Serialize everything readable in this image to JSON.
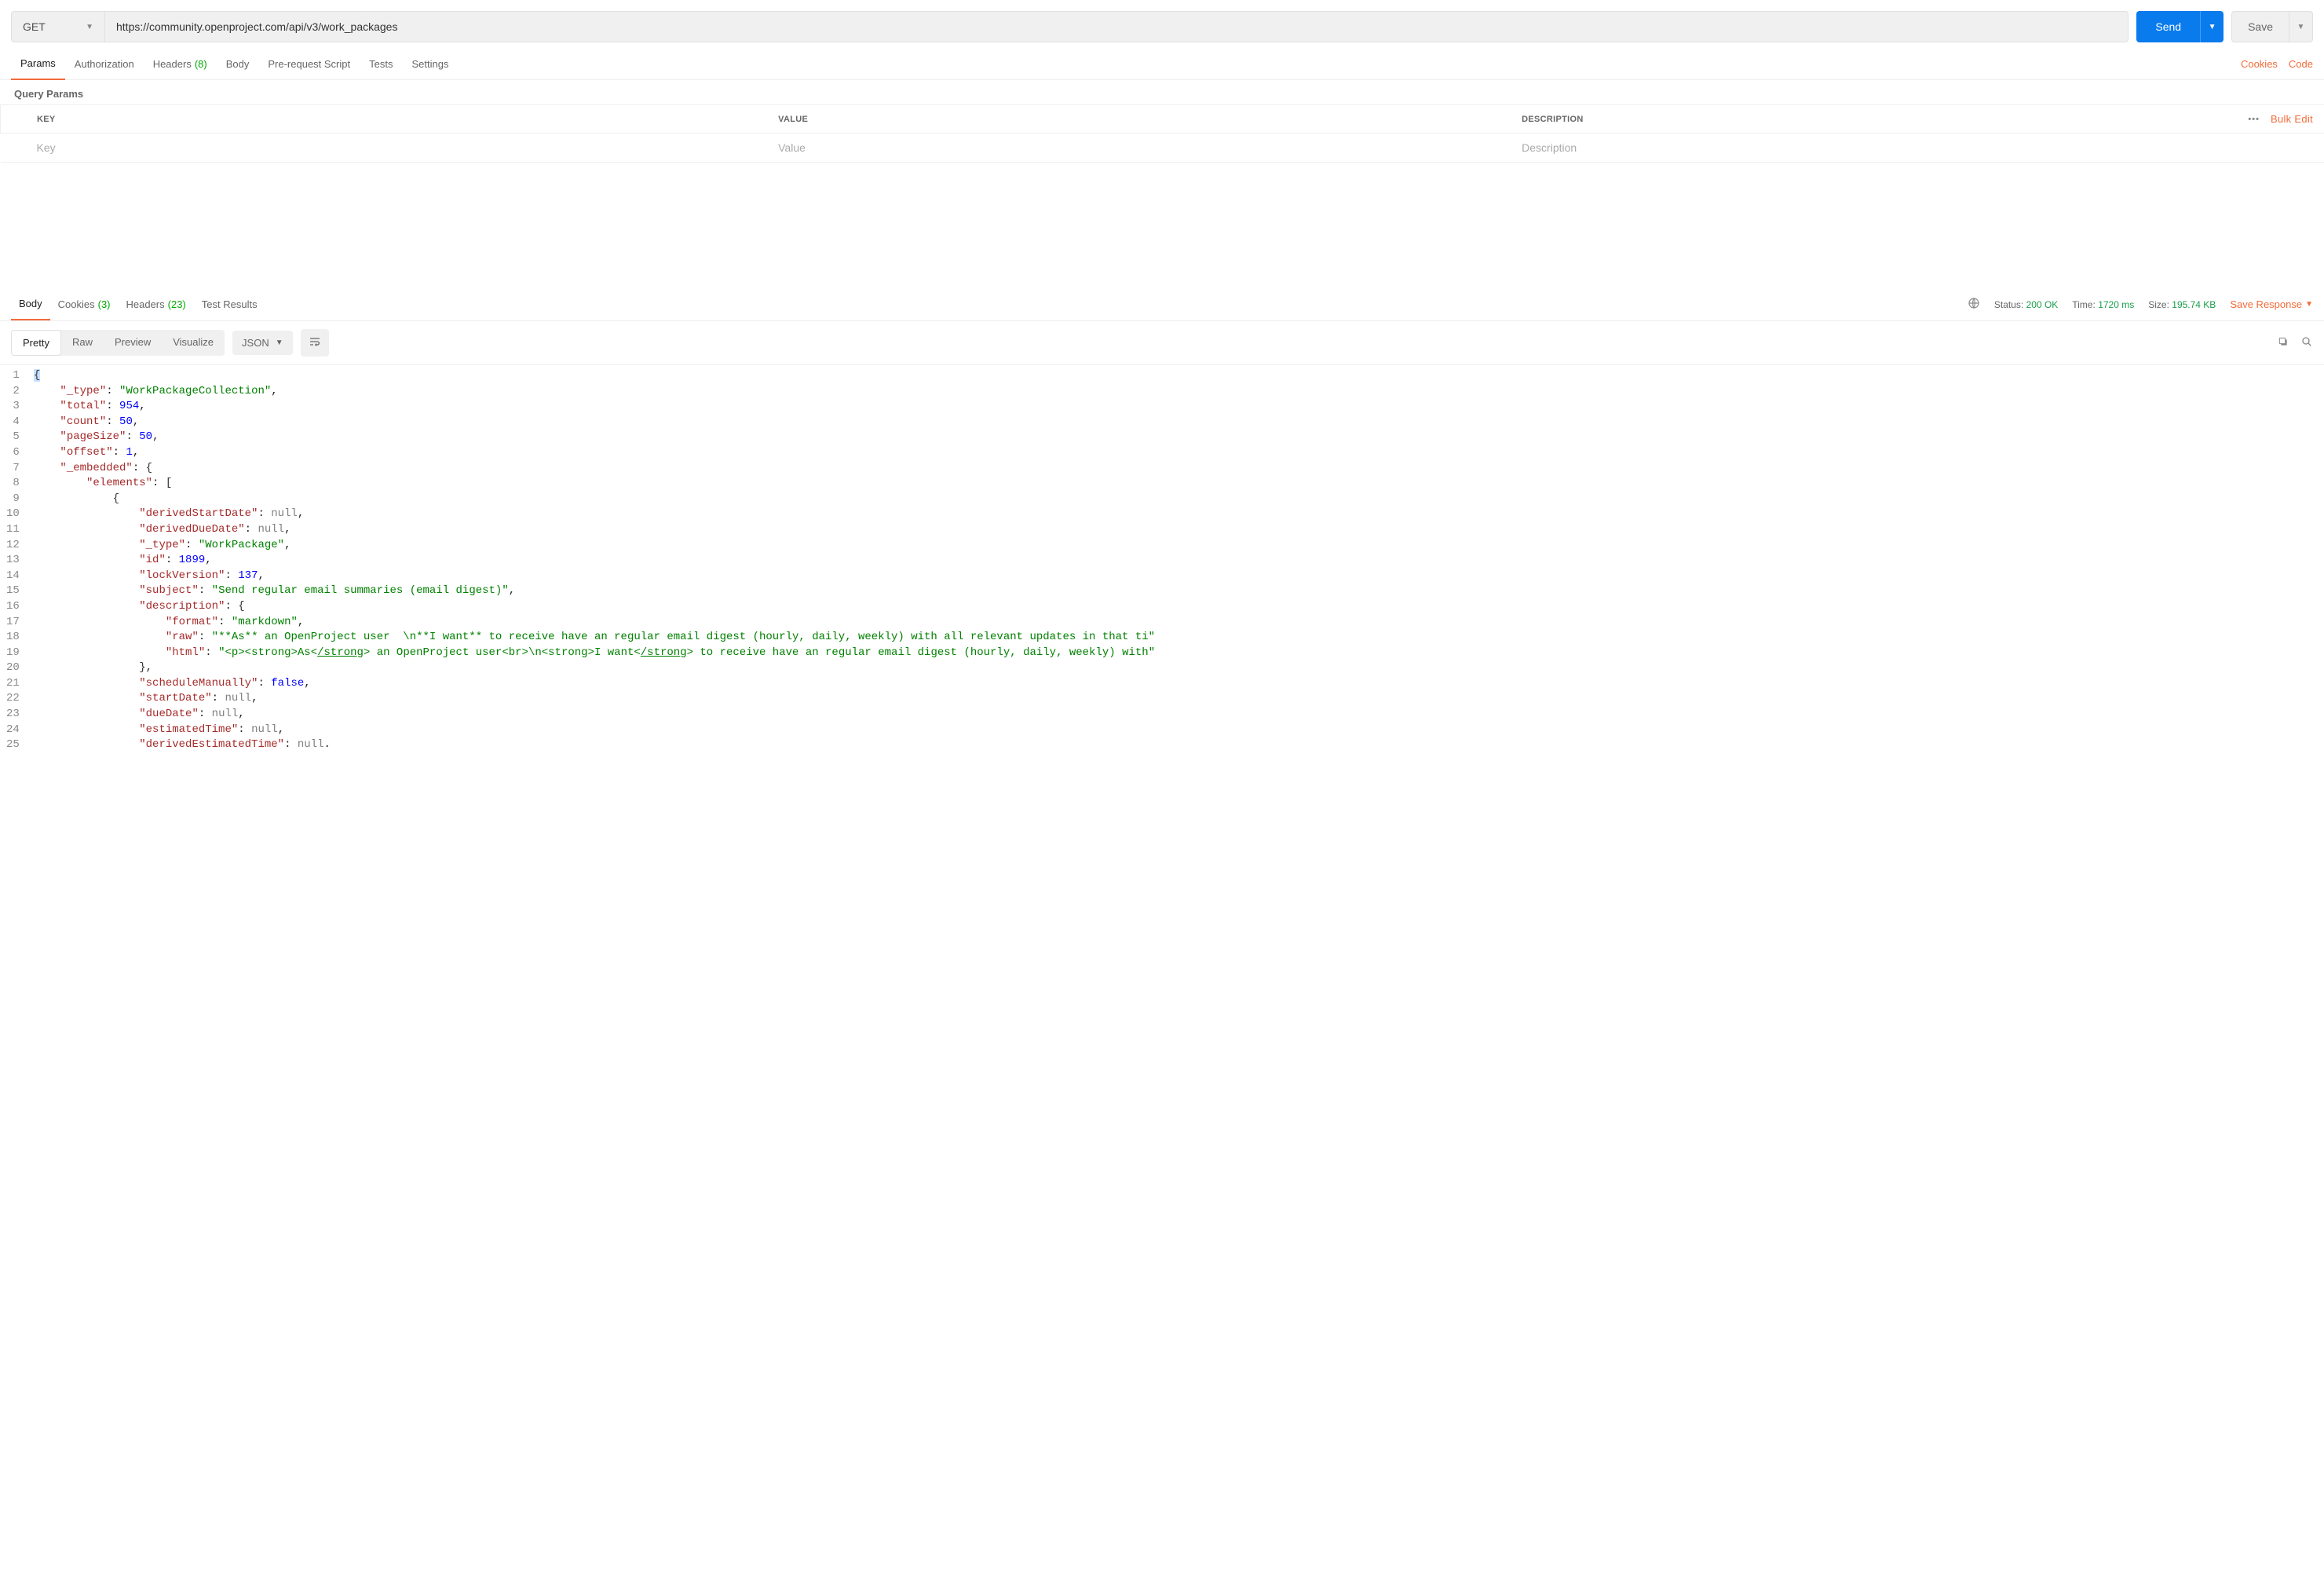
{
  "request": {
    "method": "GET",
    "url": "https://community.openproject.com/api/v3/work_packages",
    "send_label": "Send",
    "save_label": "Save"
  },
  "req_tabs": {
    "params": "Params",
    "authorization": "Authorization",
    "headers": "Headers",
    "headers_count": "(8)",
    "body": "Body",
    "prerequest": "Pre-request Script",
    "tests": "Tests",
    "settings": "Settings",
    "cookies_link": "Cookies",
    "code_link": "Code"
  },
  "query_params": {
    "title": "Query Params",
    "cols": {
      "key": "KEY",
      "value": "VALUE",
      "description": "DESCRIPTION"
    },
    "placeholders": {
      "key": "Key",
      "value": "Value",
      "description": "Description"
    },
    "bulk_edit": "Bulk Edit"
  },
  "resp_tabs": {
    "body": "Body",
    "cookies": "Cookies",
    "cookies_count": "(3)",
    "headers": "Headers",
    "headers_count": "(23)",
    "test_results": "Test Results"
  },
  "resp_meta": {
    "status_label": "Status:",
    "status_value": "200 OK",
    "time_label": "Time:",
    "time_value": "1720 ms",
    "size_label": "Size:",
    "size_value": "195.74 KB",
    "save_response": "Save Response"
  },
  "view_toolbar": {
    "pretty": "Pretty",
    "raw": "Raw",
    "preview": "Preview",
    "visualize": "Visualize",
    "format": "JSON"
  },
  "json_body": {
    "_type": "WorkPackageCollection",
    "total": 954,
    "count": 50,
    "pageSize": 50,
    "offset": 1,
    "element0": {
      "derivedStartDate": null,
      "derivedDueDate": null,
      "_type": "WorkPackage",
      "id": 1899,
      "lockVersion": 137,
      "subject": "Send regular email summaries (email digest)",
      "description_format": "markdown",
      "description_raw": "**As** an OpenProject user  \\n**I want** to receive have an regular email digest (hourly, daily, weekly) with all relevant updates in that ti",
      "description_html": "<p><strong>As</strong> an OpenProject user<br>\\n<strong>I want</strong> to receive have an regular email digest (hourly, daily, weekly) with",
      "scheduleManually": false,
      "startDate": null,
      "dueDate": null,
      "estimatedTime": null,
      "derivedEstimatedTime": null
    }
  }
}
